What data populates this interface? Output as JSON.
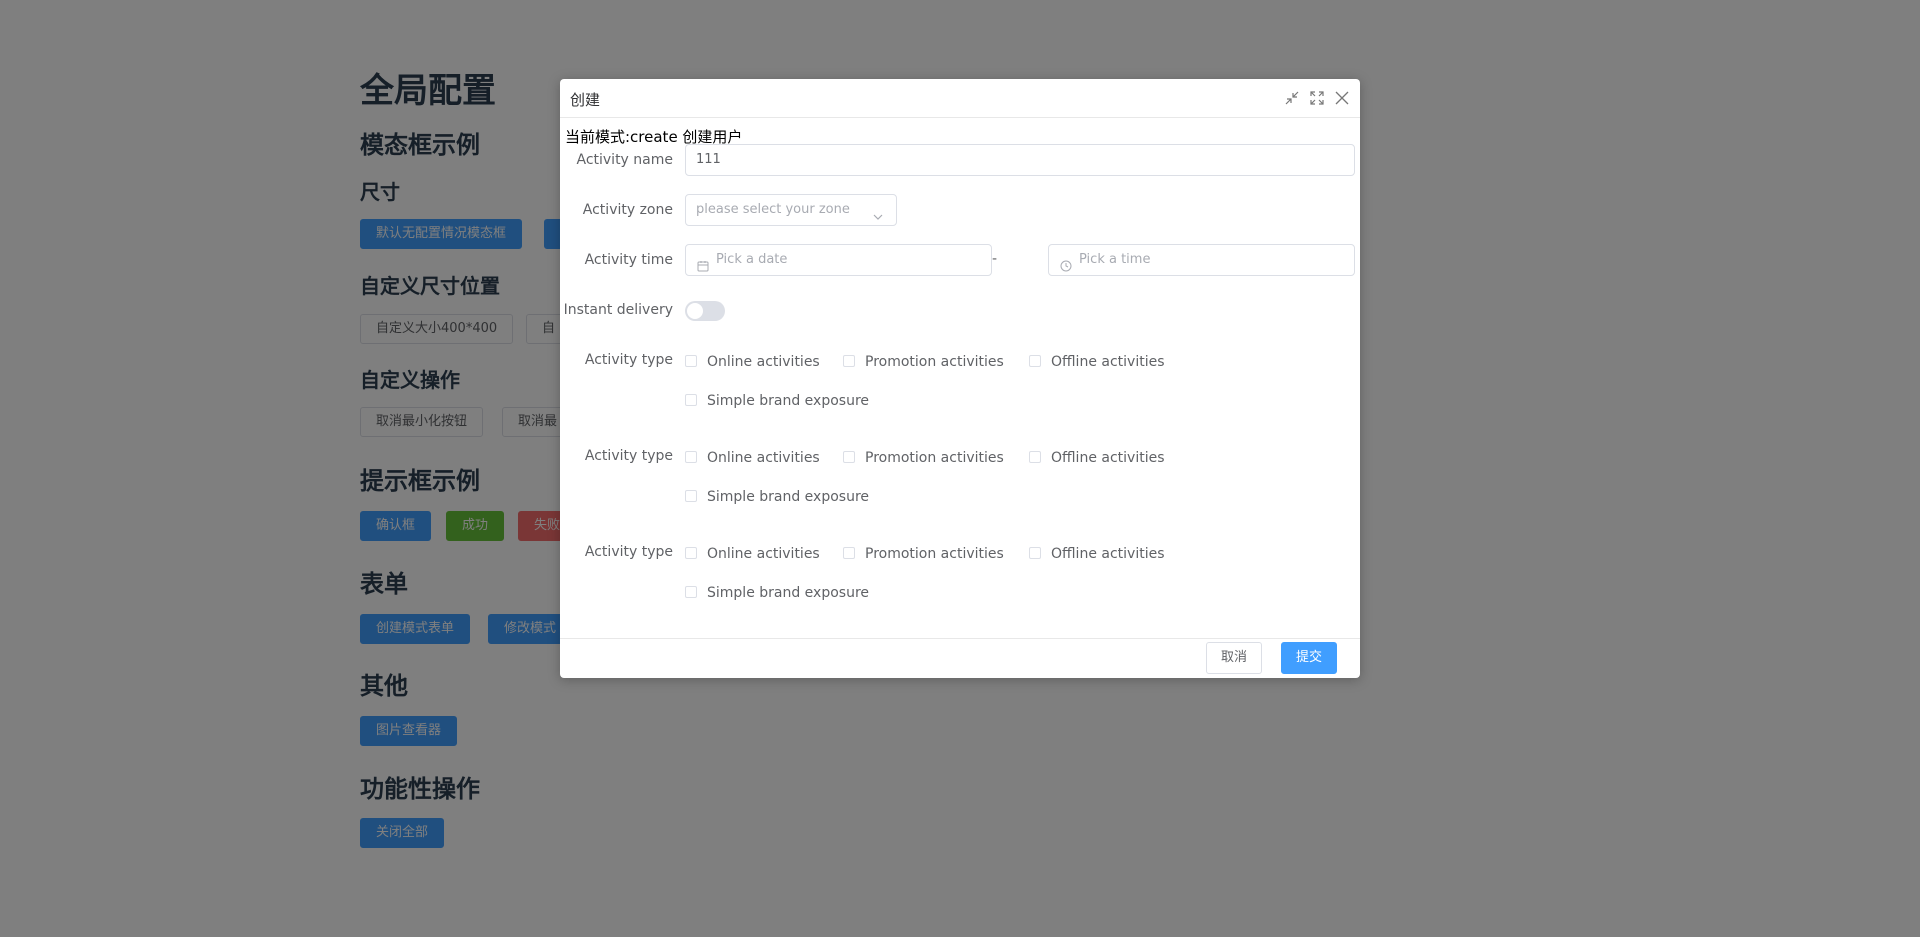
{
  "background": {
    "title": "全局配置",
    "modal_section": "模态框示例",
    "size_heading": "尺寸",
    "size_button": "默认无配置情况模态框",
    "custom_size_heading": "自定义尺寸位置",
    "custom_size_button": "自定义大小400*400",
    "custom_size_button_2": "自",
    "custom_ops_heading": "自定义操作",
    "custom_ops_button_1": "取消最小化按钮",
    "custom_ops_button_2": "取消最",
    "prompt_section": "提示框示例",
    "confirm_button": "确认框",
    "success_button": "成功",
    "fail_button": "失败",
    "form_section": "表单",
    "create_form_button": "创建模式表单",
    "edit_form_button": "修改模式",
    "other_section": "其他",
    "image_viewer_button": "图片查看器",
    "func_section": "功能性操作",
    "close_all_button": "关闭全部"
  },
  "dialog": {
    "title": "创建",
    "mode_line": "当前模式:create 创建用户",
    "fields": {
      "name_label": "Activity name",
      "name_value": "111",
      "zone_label": "Activity zone",
      "zone_placeholder": "please select your zone",
      "time_label": "Activity time",
      "date_placeholder": "Pick a date",
      "time_separator": "-",
      "time_placeholder": "Pick a time",
      "delivery_label": "Instant delivery",
      "delivery_on": false,
      "type_label": "Activity type",
      "type_options": [
        "Online activities",
        "Promotion activities",
        "Offline activities",
        "Simple brand exposure"
      ]
    },
    "footer": {
      "cancel": "取消",
      "submit": "提交"
    }
  },
  "colors": {
    "primary": "#409eff",
    "success": "#67c23a",
    "danger": "#f56c6c",
    "overlay": "rgba(0,0,0,0.5)"
  },
  "icons": [
    "minimize-icon",
    "fullscreen-icon",
    "close-icon",
    "chevron-down-icon",
    "calendar-icon",
    "clock-icon"
  ]
}
